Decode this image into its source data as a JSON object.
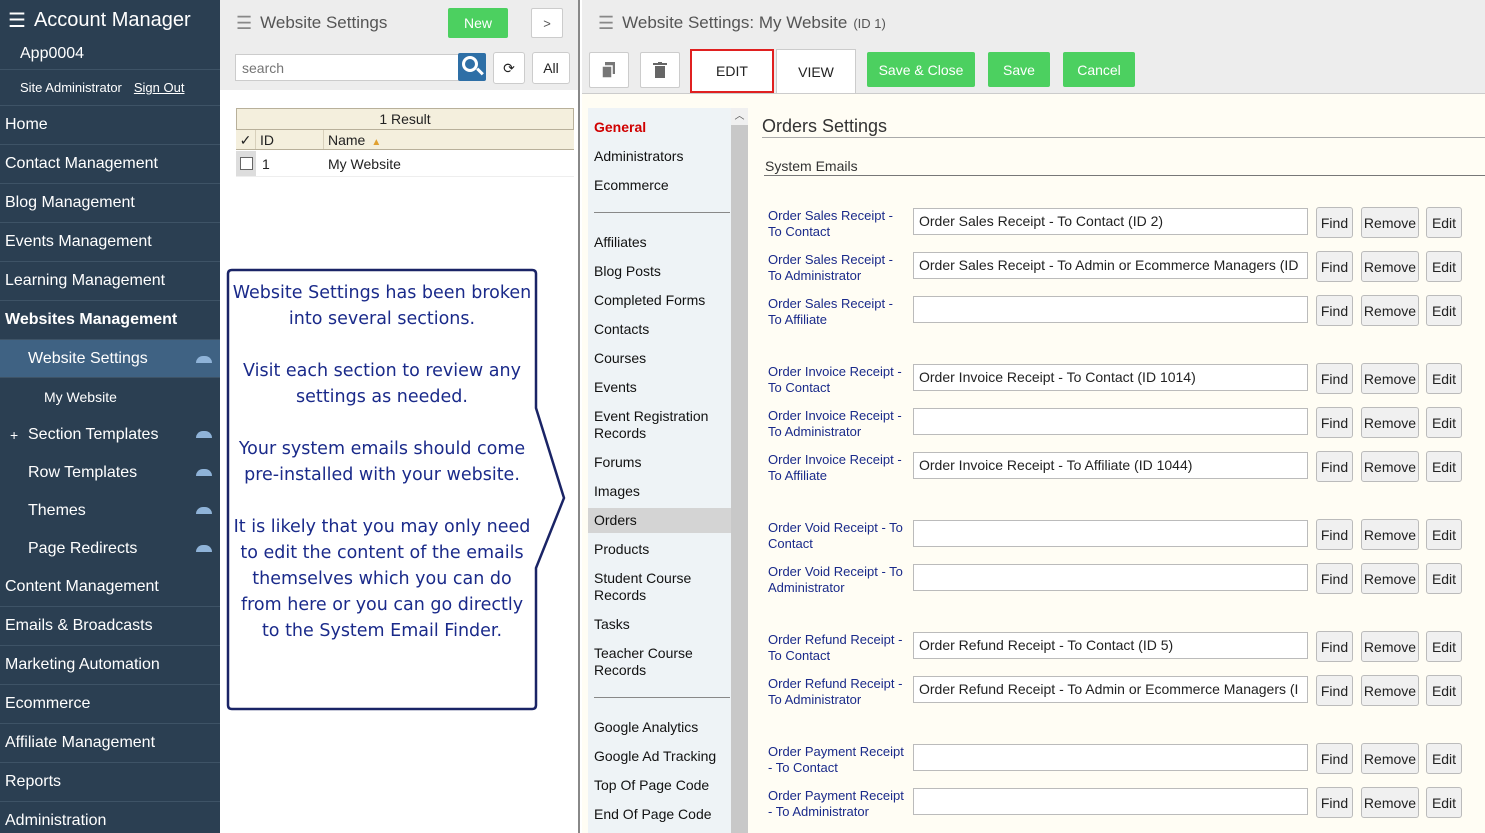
{
  "nav": {
    "title": "Account Manager",
    "app": "App0004",
    "user_role": "Site Administrator",
    "sign_out": "Sign Out",
    "items": [
      {
        "label": "Home"
      },
      {
        "label": "Contact Management"
      },
      {
        "label": "Blog Management"
      },
      {
        "label": "Events Management"
      },
      {
        "label": "Learning Management"
      },
      {
        "label": "Websites Management"
      }
    ],
    "website_settings": "Website Settings",
    "my_website": "My Website",
    "section_templates": "Section Templates",
    "row_templates": "Row Templates",
    "themes": "Themes",
    "page_redirects": "Page Redirects",
    "lower_items": [
      {
        "label": "Content Management"
      },
      {
        "label": "Emails & Broadcasts"
      },
      {
        "label": "Marketing Automation"
      },
      {
        "label": "Ecommerce"
      },
      {
        "label": "Affiliate Management"
      },
      {
        "label": "Reports"
      },
      {
        "label": "Administration"
      }
    ]
  },
  "list": {
    "title": "Website Settings",
    "new_label": "New",
    "next_label": ">",
    "search_placeholder": "search",
    "refresh_label": "⟳",
    "all_label": "All",
    "result_count": "1 Result",
    "col_check": "✓",
    "col_id": "ID",
    "col_name": "Name",
    "rows": [
      {
        "id": "1",
        "name": "My Website"
      }
    ]
  },
  "callout": {
    "p1": "Website Settings has been broken into several sections.",
    "p2": "Visit each section to review any settings as needed.",
    "p3": "Your system emails should come pre-installed with your website.",
    "p4": "It is likely that you may only need to edit the content of the emails themselves which you can do from here or you can go directly to the System Email Finder."
  },
  "main": {
    "title": "Website Settings: My Website",
    "id_tag": "(ID 1)",
    "tab_edit": "EDIT",
    "tab_view": "VIEW",
    "save_close": "Save & Close",
    "save": "Save",
    "cancel": "Cancel",
    "sections": {
      "general": "General",
      "administrators": "Administrators",
      "ecommerce": "Ecommerce",
      "affiliates": "Affiliates",
      "blog_posts": "Blog Posts",
      "completed_forms": "Completed Forms",
      "contacts": "Contacts",
      "courses": "Courses",
      "events": "Events",
      "event_reg": "Event Registration Records",
      "forums": "Forums",
      "images": "Images",
      "orders": "Orders",
      "products": "Products",
      "student_course": "Student Course Records",
      "tasks": "Tasks",
      "teacher_course": "Teacher Course Records",
      "google_analytics": "Google Analytics",
      "google_ad": "Google Ad Tracking",
      "top_code": "Top Of Page Code",
      "end_code": "End Of Page Code"
    },
    "pane_title": "Orders Settings",
    "pane_sub": "System Emails",
    "find": "Find",
    "remove": "Remove",
    "edit": "Edit",
    "emails": [
      {
        "label": "Order Sales Receipt - To Contact",
        "value": "Order Sales Receipt - To Contact (ID 2)"
      },
      {
        "label": "Order Sales Receipt - To Administrator",
        "value": "Order Sales Receipt - To Admin or Ecommerce Managers (ID"
      },
      {
        "label": "Order Sales Receipt - To Affiliate",
        "value": ""
      },
      {
        "label": "Order Invoice Receipt - To Contact",
        "value": "Order Invoice Receipt - To Contact (ID 1014)"
      },
      {
        "label": "Order Invoice Receipt - To Administrator",
        "value": ""
      },
      {
        "label": "Order Invoice Receipt - To Affiliate",
        "value": "Order Invoice Receipt - To Affiliate (ID 1044)"
      },
      {
        "label": "Order Void Receipt - To Contact",
        "value": ""
      },
      {
        "label": "Order Void Receipt - To Administrator",
        "value": ""
      },
      {
        "label": "Order Refund Receipt - To Contact",
        "value": "Order Refund Receipt - To Contact (ID 5)"
      },
      {
        "label": "Order Refund Receipt - To Administrator",
        "value": "Order Refund Receipt - To Admin or Ecommerce Managers (I"
      },
      {
        "label": "Order Payment Receipt - To Contact",
        "value": ""
      },
      {
        "label": "Order Payment Receipt - To Administrator",
        "value": ""
      }
    ]
  }
}
